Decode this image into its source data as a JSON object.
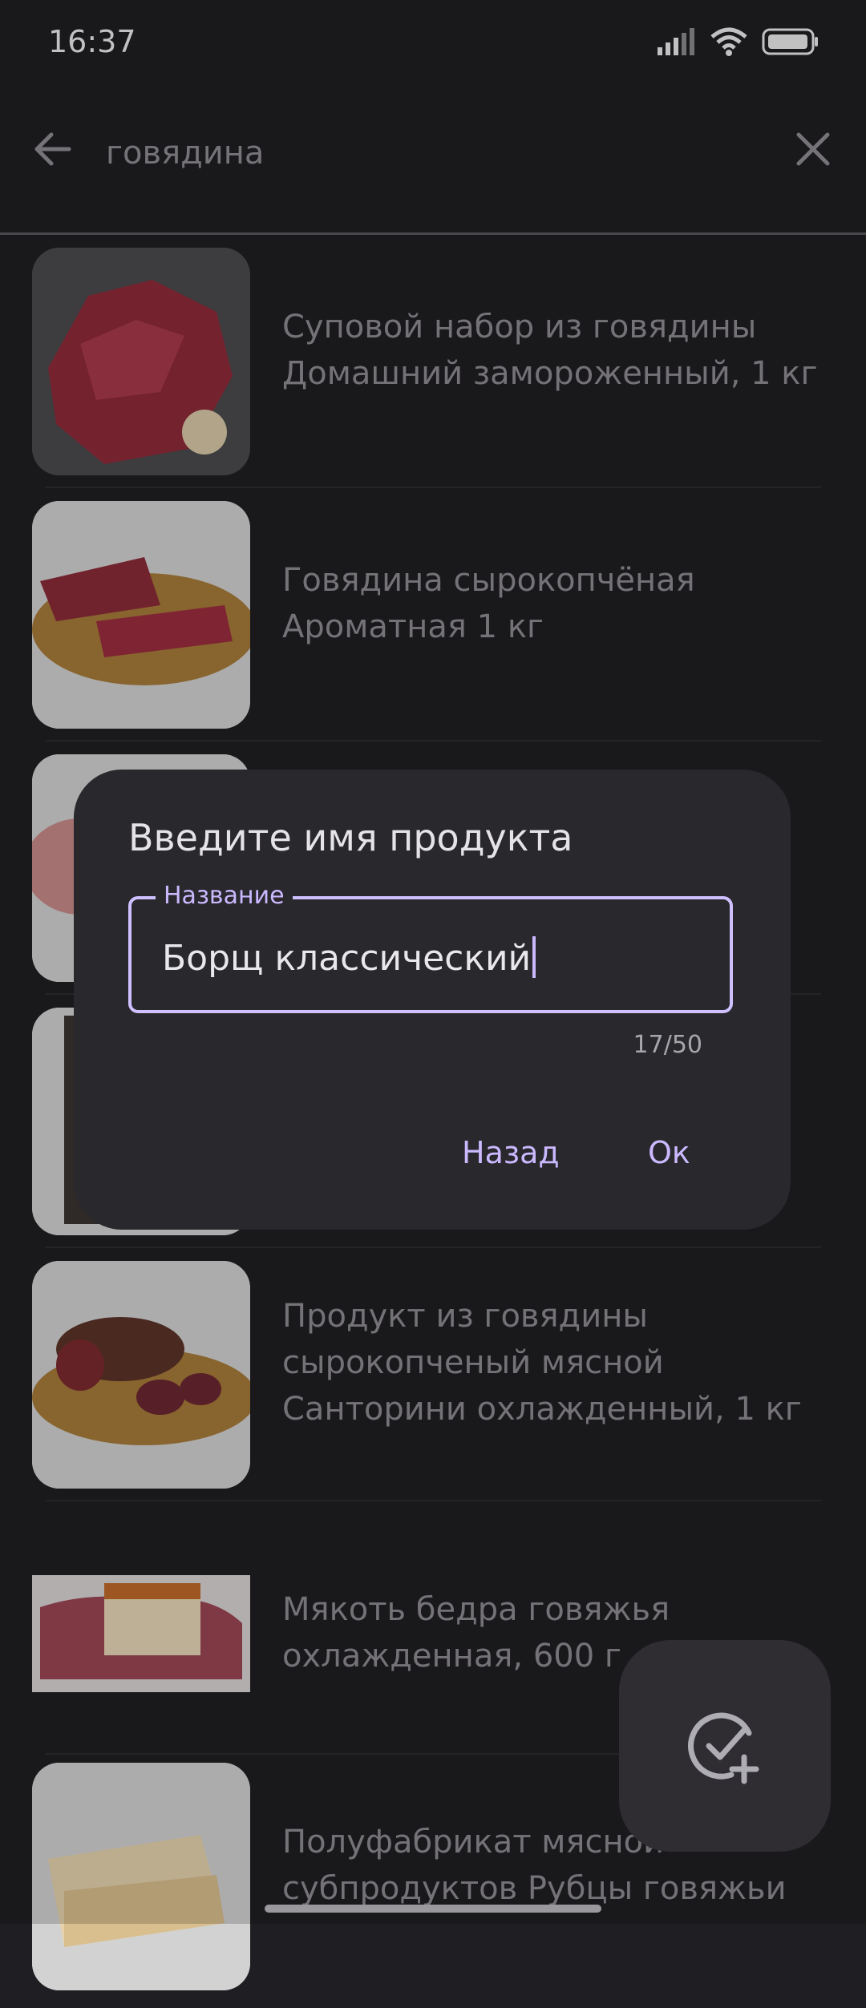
{
  "status_bar": {
    "time": "16:37",
    "battery_level": 0.9
  },
  "search": {
    "query": "говядина"
  },
  "products": [
    {
      "title": "Суповой набор из говядины Домашний замороженный, 1 кг"
    },
    {
      "title": "Говядина сырокопчёная Ароматная 1 кг"
    },
    {
      "title": ""
    },
    {
      "title": ""
    },
    {
      "title": "Продукт из говядины сырокопченый мясной Санторини охлажденный, 1 кг"
    },
    {
      "title": "Мякоть бедра говяжья охлажденная, 600 г"
    },
    {
      "title": "Полуфабрикат мясной субпродуктов Рубцы говяжьи"
    }
  ],
  "dialog": {
    "title": "Введите имя продукта",
    "field_label": "Название",
    "field_value": "Борщ классический",
    "counter": "17/50",
    "back_label": "Назад",
    "ok_label": "Ок"
  },
  "icons": {
    "back": "arrow-back-icon",
    "clear": "close-icon",
    "fab": "check-plus-icon"
  },
  "colors": {
    "accent": "#cbb9ff",
    "background": "#1f1e22",
    "dialog": "#29282c"
  }
}
